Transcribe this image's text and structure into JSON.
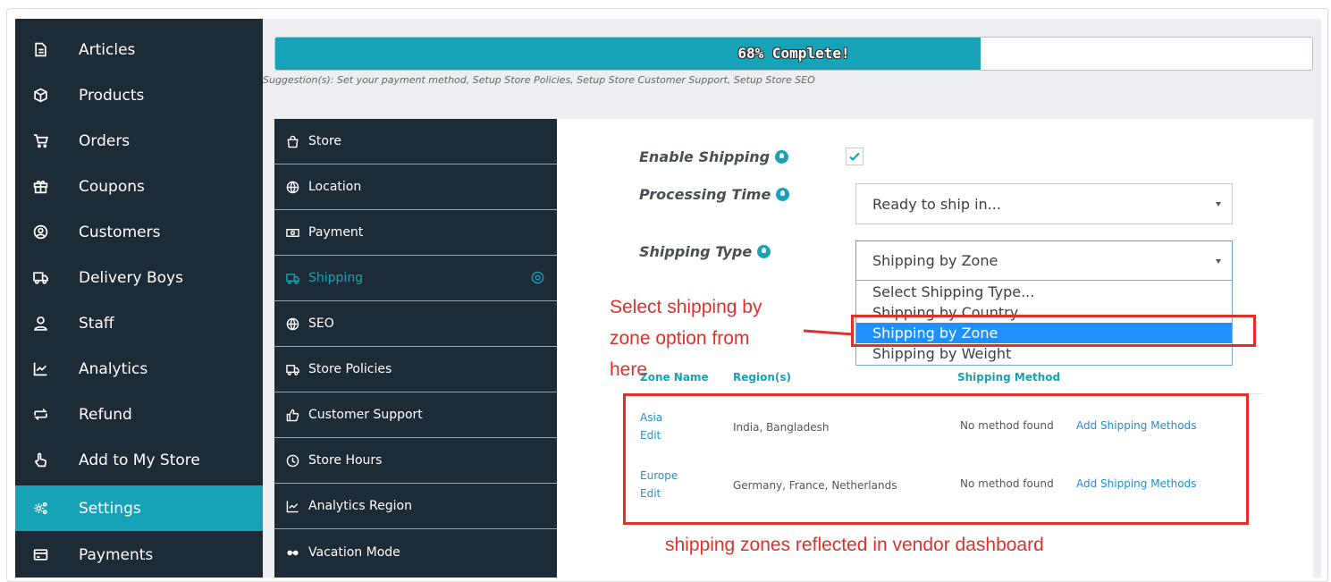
{
  "sidebar": {
    "items": [
      {
        "label": "Articles",
        "icon": "document-icon"
      },
      {
        "label": "Products",
        "icon": "cube-icon"
      },
      {
        "label": "Orders",
        "icon": "cart-icon"
      },
      {
        "label": "Coupons",
        "icon": "gift-icon"
      },
      {
        "label": "Customers",
        "icon": "user-circle-icon"
      },
      {
        "label": "Delivery Boys",
        "icon": "truck-icon"
      },
      {
        "label": "Staff",
        "icon": "user-icon"
      },
      {
        "label": "Analytics",
        "icon": "chart-line-icon"
      },
      {
        "label": "Refund",
        "icon": "refund-icon"
      },
      {
        "label": "Add to My Store",
        "icon": "hand-pointer-icon"
      },
      {
        "label": "Settings",
        "icon": "cogs-icon",
        "active": true
      },
      {
        "label": "Payments",
        "icon": "credit-card-icon"
      }
    ]
  },
  "progress": {
    "text": "68% Complete!",
    "percent": 68
  },
  "suggestion": "Suggestion(s): Set your payment method, Setup Store Policies, Setup Store Customer Support, Setup Store SEO",
  "settings_menu": {
    "items": [
      {
        "label": "Store",
        "icon": "bag-icon"
      },
      {
        "label": "Location",
        "icon": "globe-icon"
      },
      {
        "label": "Payment",
        "icon": "money-icon"
      },
      {
        "label": "Shipping",
        "icon": "truck-icon",
        "active": true
      },
      {
        "label": "SEO",
        "icon": "globe-icon"
      },
      {
        "label": "Store Policies",
        "icon": "truck-icon"
      },
      {
        "label": "Customer Support",
        "icon": "thumbs-up-icon"
      },
      {
        "label": "Store Hours",
        "icon": "clock-icon"
      },
      {
        "label": "Analytics Region",
        "icon": "chart-line-icon"
      },
      {
        "label": "Vacation Mode",
        "icon": "glasses-icon"
      }
    ]
  },
  "form": {
    "enable_shipping_label": "Enable Shipping",
    "enable_shipping_checked": true,
    "processing_time_label": "Processing Time",
    "processing_time_value": "Ready to ship in...",
    "shipping_type_label": "Shipping Type",
    "shipping_type_value": "Shipping by Zone",
    "shipping_type_options": [
      "Select Shipping Type...",
      "Shipping by Country",
      "Shipping by Zone",
      "Shipping by Weight"
    ],
    "selected_option": "Shipping by Zone"
  },
  "table": {
    "headers": {
      "zone": "Zone Name",
      "region": "Region(s)",
      "method": "Shipping Method"
    },
    "rows": [
      {
        "zone": "Asia",
        "edit": "Edit",
        "regions": "India, Bangladesh",
        "method": "No method found",
        "action": "Add Shipping Methods"
      },
      {
        "zone": "Europe",
        "edit": "Edit",
        "regions": "Germany, France, Netherlands",
        "method": "No method found",
        "action": "Add Shipping Methods"
      }
    ]
  },
  "annotations": {
    "select_line1": "Select shipping by",
    "select_line2": "zone option from",
    "select_line3": "here",
    "bottom": "shipping zones reflected in vendor dashboard"
  },
  "colors": {
    "accent": "#17a2b8",
    "sidebar": "#1d2b36",
    "annotation": "#e0302a",
    "link": "#1e8fd6",
    "option_selected": "#1e90ff"
  }
}
